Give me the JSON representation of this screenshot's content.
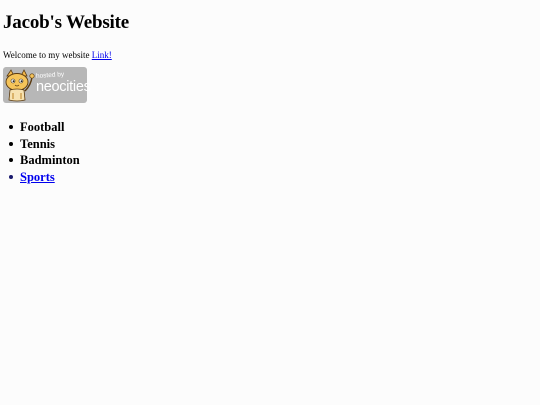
{
  "header": {
    "title": "Jacob's Website"
  },
  "intro": {
    "text": "Welcome to my website",
    "link_label": "Link!"
  },
  "badge": {
    "hosted_text": "hosted by",
    "brand_text": "neocities",
    "icon": "neocities-cat-icon"
  },
  "list": {
    "items": [
      {
        "label": "Football"
      },
      {
        "label": "Tennis"
      },
      {
        "label": "Badminton"
      }
    ],
    "link_item": {
      "label": "Sports"
    }
  },
  "colors": {
    "background": "#fcfcfc",
    "link": "#0000ee",
    "badge": "#b7b7b7"
  }
}
